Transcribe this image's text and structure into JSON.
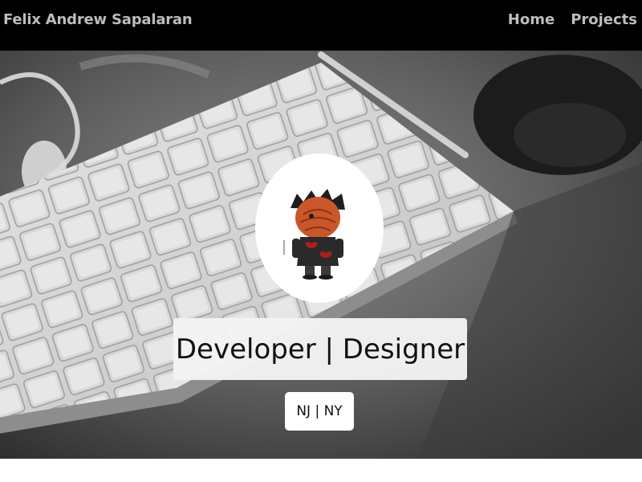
{
  "navbar": {
    "brand": "Felix Andrew Sapalaran",
    "links": [
      {
        "label": "Home"
      },
      {
        "label": "Projects"
      }
    ]
  },
  "hero": {
    "headline": "Developer | Designer",
    "location": "NJ | NY",
    "background_icon": "keyboard-photo",
    "avatar_icon": "masked-ninja-figure"
  },
  "colors": {
    "navbar_bg": "#000000",
    "nav_text": "#bdbdbd",
    "hero_tint": "#5a5a5a",
    "card_bg": "#f4f4f4",
    "avatar_mask": "#c9572a",
    "avatar_cloak": "#2a2a2a",
    "cloud_red": "#a8201a"
  }
}
